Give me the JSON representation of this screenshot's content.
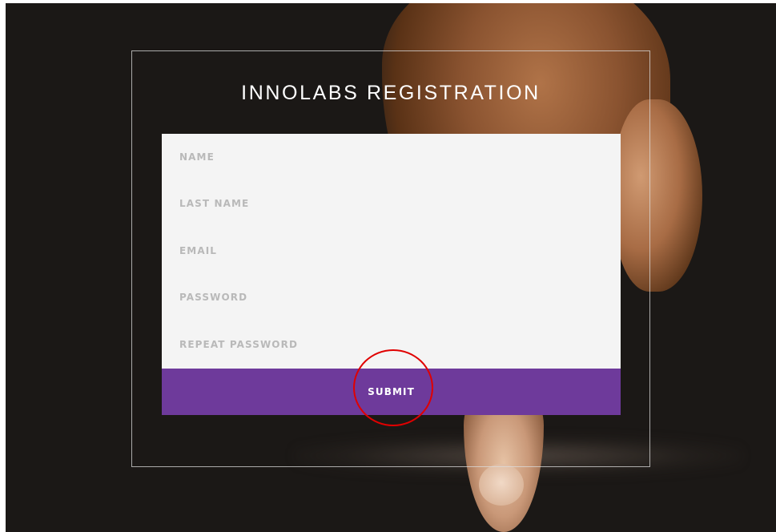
{
  "page": {
    "title": "INNOLABS REGISTRATION"
  },
  "form": {
    "fields": [
      {
        "placeholder": "NAME"
      },
      {
        "placeholder": "LAST NAME"
      },
      {
        "placeholder": "EMAIL"
      },
      {
        "placeholder": "PASSWORD"
      },
      {
        "placeholder": "REPEAT PASSWORD"
      }
    ],
    "submit_label": "SUBMIT"
  },
  "colors": {
    "background": "#1b1816",
    "form_background": "#f4f4f4",
    "placeholder": "#b9b9b9",
    "submit_button": "#6e3a9b",
    "annotation": "#e00000"
  }
}
